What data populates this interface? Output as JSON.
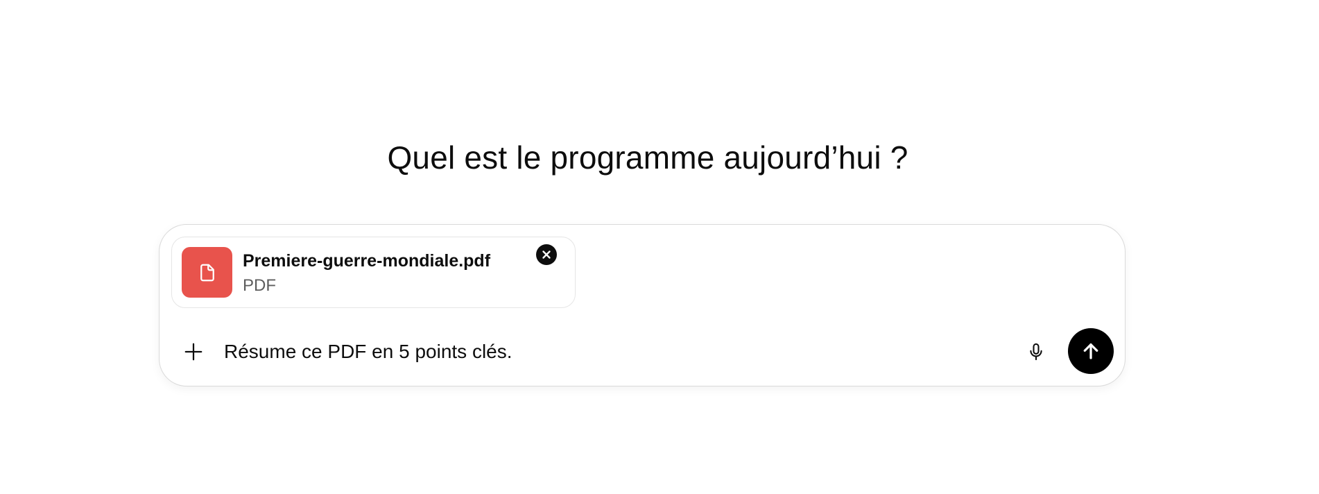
{
  "heading": "Quel est le programme aujourd’hui ?",
  "composer": {
    "attachment": {
      "file_name": "Premiere-guerre-mondiale.pdf",
      "file_type": "PDF",
      "icon": "document-icon",
      "icon_color": "#e8534c"
    },
    "remove_icon": "close-icon",
    "add_icon": "plus-icon",
    "prompt_value": "Résume ce PDF en 5 points clés.",
    "mic_icon": "microphone-icon",
    "send_icon": "arrow-up-icon"
  }
}
